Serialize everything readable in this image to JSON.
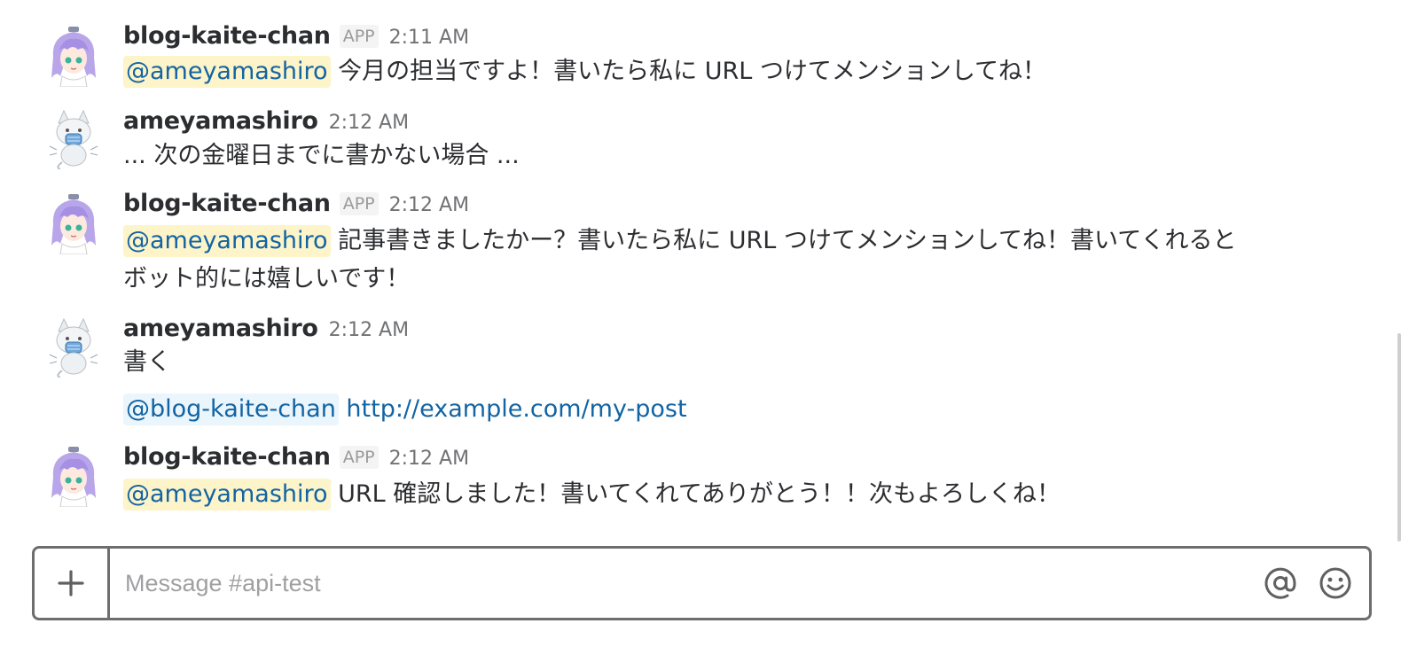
{
  "messages": [
    {
      "sender": "blog-kaite-chan",
      "badge": "APP",
      "time": "2:11 AM",
      "mention": "@ameyamashiro",
      "text": "今月の担当ですよ！書いたら私に URL つけてメンションしてね！"
    },
    {
      "sender": "ameyamashiro",
      "time": "2:12 AM",
      "text": "... 次の金曜日までに書かない場合 ..."
    },
    {
      "sender": "blog-kaite-chan",
      "badge": "APP",
      "time": "2:12 AM",
      "mention": "@ameyamashiro",
      "text_line1": "記事書きましたかー？書いたら私に URL つけてメンションしてね！書いてくれると",
      "text_line2": "ボット的には嬉しいです！"
    },
    {
      "sender": "ameyamashiro",
      "time": "2:12 AM",
      "text": "書く",
      "followup_mention": "@blog-kaite-chan",
      "followup_link": "http://example.com/my-post"
    },
    {
      "sender": "blog-kaite-chan",
      "badge": "APP",
      "time": "2:12 AM",
      "mention": "@ameyamashiro",
      "text": "URL 確認しました！書いてくれてありがとう！！次もよろしくね！"
    }
  ],
  "composer": {
    "placeholder": "Message #api-test",
    "value": ""
  },
  "icons": {
    "plus": "plus-icon",
    "mention": "at-sign-icon",
    "emoji": "smiley-icon",
    "bot_avatar": "anime-girl-avatar",
    "user_avatar": "cat-avatar"
  },
  "colors": {
    "mention_text": "#1264a3",
    "mention_bg_self": "#fdf4c9",
    "mention_bg_other": "#eaf5fc",
    "border": "#6e6e70"
  }
}
